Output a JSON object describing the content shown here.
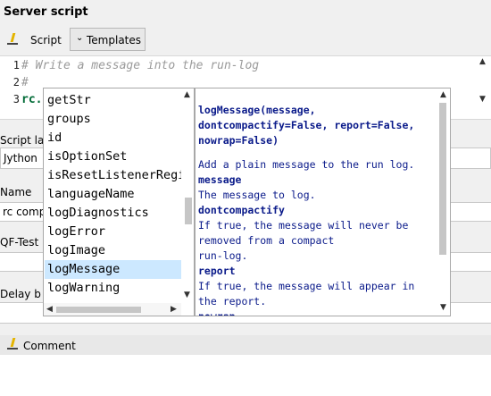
{
  "header": {
    "title": "Server script",
    "script_label": "Script",
    "templates_label": "Templates"
  },
  "editor": {
    "line_numbers": [
      "1",
      "2",
      "3"
    ],
    "lines": [
      "# Write a message into the run-log",
      "#",
      "rc."
    ]
  },
  "form": {
    "script_language_label": "Script la",
    "script_language_value": "Jython",
    "name_label": "Name",
    "name_value": "rc comp",
    "qftest_label": "QF-Test",
    "delay_label": "Delay b",
    "comment_label": "Comment"
  },
  "completion": {
    "items": [
      "getStr",
      "groups",
      "id",
      "isOptionSet",
      "isResetListenerRegi",
      "languageName",
      "logDiagnostics",
      "logError",
      "logImage",
      "logMessage",
      "logWarning"
    ],
    "selected": "logMessage"
  },
  "doc": {
    "signature": [
      "logMessage(message,",
      "dontcompactify=False, report=False,",
      "nowrap=False)"
    ],
    "description": "Add a plain message to the run log.",
    "params": [
      {
        "name": "message",
        "text": [
          "The message to log."
        ]
      },
      {
        "name": "dontcompactify",
        "text": [
          "If true, the message will never be",
          "removed from a compact",
          "run-log."
        ]
      },
      {
        "name": "report",
        "text": [
          "If true, the message will appear in",
          "the report."
        ]
      },
      {
        "name": "nowrap",
        "text": []
      }
    ]
  }
}
